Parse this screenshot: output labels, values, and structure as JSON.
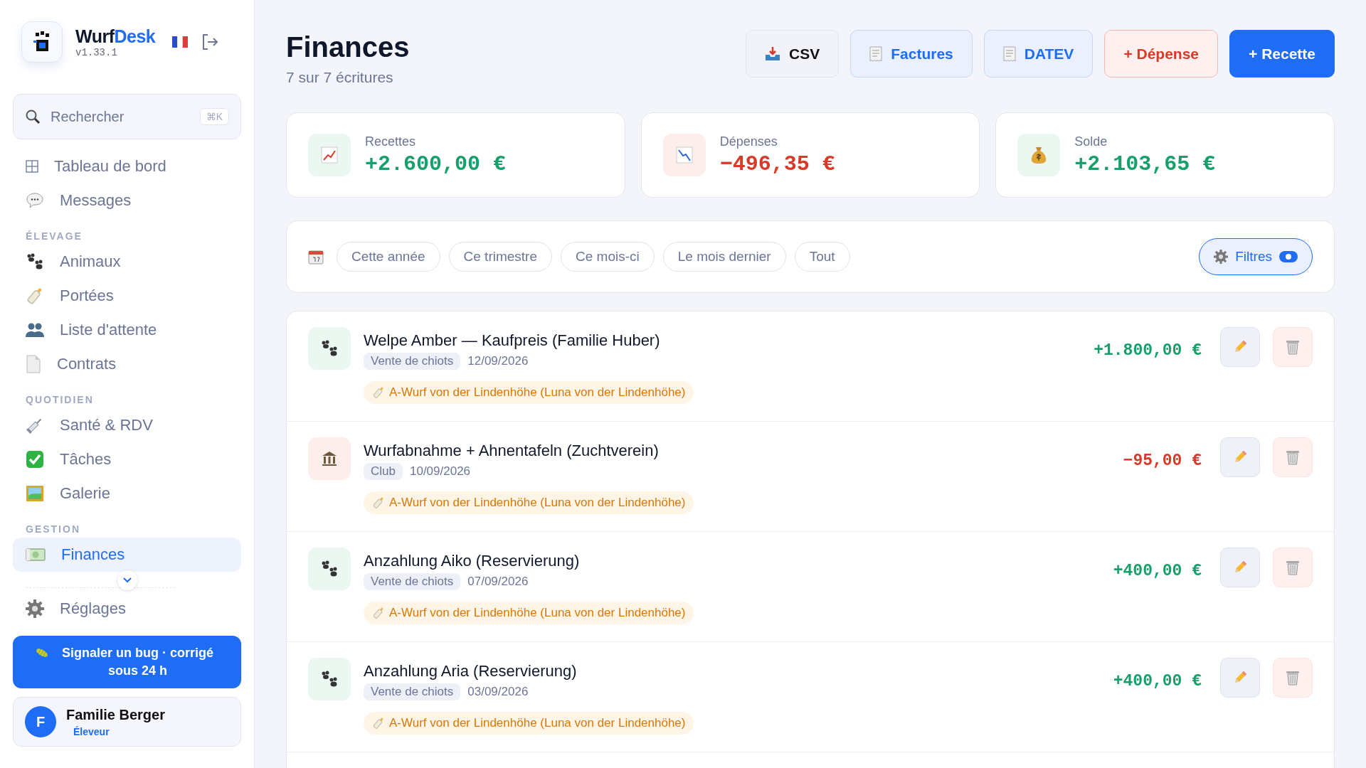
{
  "brand": {
    "name_dark": "Wurf",
    "name_accent": "Desk",
    "version": "v1.33.1"
  },
  "search": {
    "placeholder": "Rechercher",
    "shortcut": "⌘K"
  },
  "nav": [
    {
      "items": [
        {
          "label": "Tableau de bord",
          "selected": false
        },
        {
          "label": "Messages",
          "selected": false
        }
      ]
    },
    {
      "heading": "ÉLEVAGE",
      "items": [
        {
          "label": "Animaux",
          "selected": false
        },
        {
          "label": "Portées",
          "selected": false
        },
        {
          "label": "Liste d'attente",
          "selected": false
        },
        {
          "label": "Contrats",
          "selected": false
        }
      ]
    },
    {
      "heading": "QUOTIDIEN",
      "items": [
        {
          "label": "Santé & RDV",
          "selected": false
        },
        {
          "label": "Tâches",
          "selected": false
        },
        {
          "label": "Galerie",
          "selected": false
        }
      ]
    },
    {
      "heading": "GESTION",
      "items": [
        {
          "label": "Finances",
          "selected": true
        }
      ]
    }
  ],
  "settings": {
    "label": "Réglages"
  },
  "bug_button": {
    "label": "Signaler un bug · corrigé sous 24 h"
  },
  "user": {
    "initial": "F",
    "name": "Familie Berger",
    "role": "Éleveur"
  },
  "header": {
    "title": "Finances",
    "subtitle": "7 sur 7 écritures"
  },
  "actions": [
    {
      "kind": "neutral",
      "label": "CSV"
    },
    {
      "kind": "soft",
      "label": "Factures"
    },
    {
      "kind": "soft",
      "label": "DATEV"
    },
    {
      "kind": "danger",
      "label": "+ Dépense"
    },
    {
      "kind": "primary",
      "label": "+ Recette"
    }
  ],
  "stats": [
    {
      "kind": "income",
      "label": "Recettes",
      "value": "+2.600,00 €"
    },
    {
      "kind": "expense",
      "label": "Dépenses",
      "value": "−496,35 €"
    },
    {
      "kind": "balance",
      "label": "Solde",
      "value": "+2.103,65 €"
    }
  ],
  "periods": [
    {
      "label": "Cette année",
      "selected": false
    },
    {
      "label": "Ce trimestre",
      "selected": false
    },
    {
      "label": "Ce mois-ci",
      "selected": false
    },
    {
      "label": "Le mois dernier",
      "selected": false
    },
    {
      "label": "Tout",
      "selected": false
    }
  ],
  "filters": {
    "label": "Filtres",
    "on": true
  },
  "entries": [
    {
      "kind": "income",
      "title": "Welpe Amber — Kaufpreis (Familie Huber)",
      "category": "Vente de chiots",
      "date": "12/09/2026",
      "litter": "A-Wurf von der Lindenhöhe (Luna von der Lindenhöhe)",
      "amount": "+1.800,00 €"
    },
    {
      "kind": "expense",
      "title": "Wurfabnahme + Ahnentafeln (Zuchtverein)",
      "category": "Club",
      "date": "10/09/2026",
      "litter": "A-Wurf von der Lindenhöhe (Luna von der Lindenhöhe)",
      "amount": "−95,00 €"
    },
    {
      "kind": "income",
      "title": "Anzahlung Aiko (Reservierung)",
      "category": "Vente de chiots",
      "date": "07/09/2026",
      "litter": "A-Wurf von der Lindenhöhe (Luna von der Lindenhöhe)",
      "amount": "+400,00 €"
    },
    {
      "kind": "income",
      "title": "Anzahlung Aria (Reservierung)",
      "category": "Vente de chiots",
      "date": "03/09/2026",
      "litter": "A-Wurf von der Lindenhöhe (Luna von der Lindenhöhe)",
      "amount": "+400,00 €"
    }
  ]
}
